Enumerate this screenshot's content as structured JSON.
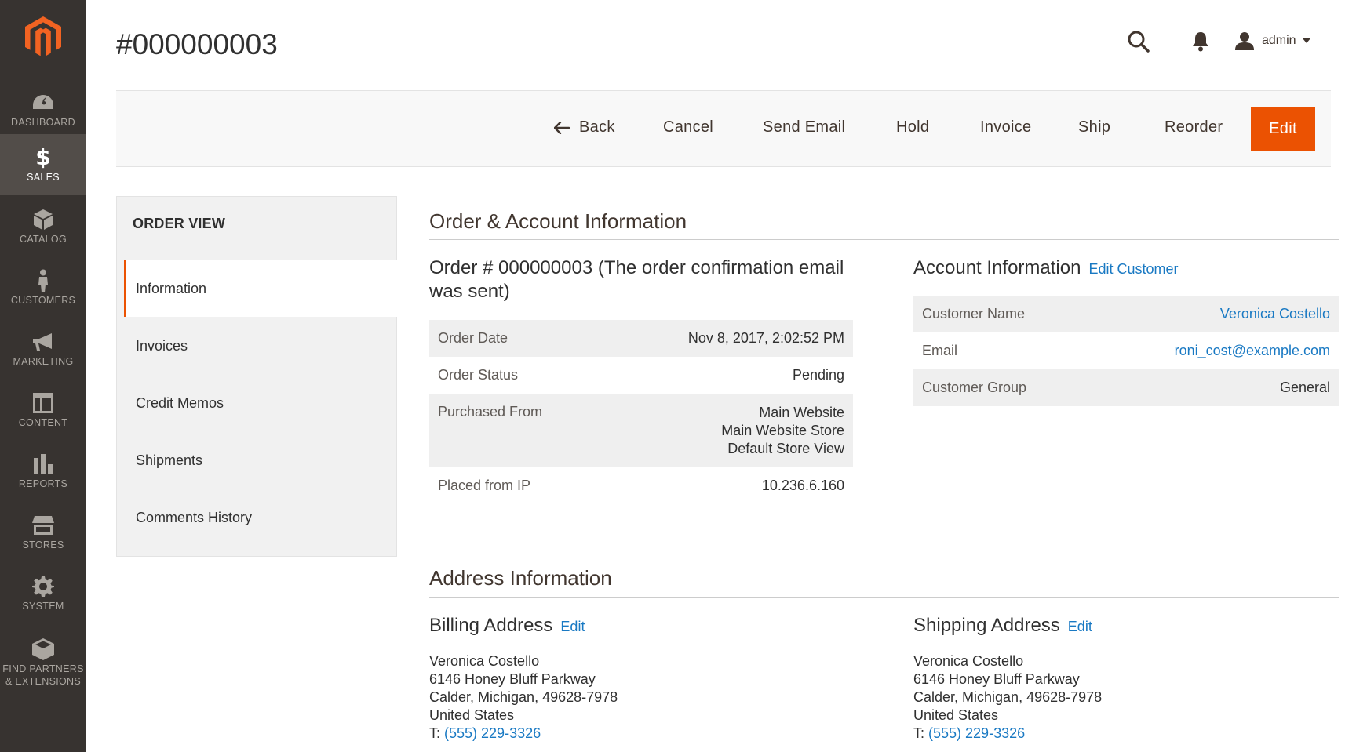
{
  "nav": {
    "items": [
      {
        "label": "DASHBOARD",
        "icon": "dashboard-icon"
      },
      {
        "label": "SALES",
        "icon": "dollar-icon",
        "active": true
      },
      {
        "label": "CATALOG",
        "icon": "box-icon"
      },
      {
        "label": "CUSTOMERS",
        "icon": "person-icon"
      },
      {
        "label": "MARKETING",
        "icon": "megaphone-icon"
      },
      {
        "label": "CONTENT",
        "icon": "layout-icon"
      },
      {
        "label": "REPORTS",
        "icon": "bar-chart-icon"
      },
      {
        "label": "STORES",
        "icon": "storefront-icon"
      },
      {
        "label": "SYSTEM",
        "icon": "gear-icon"
      },
      {
        "label": "FIND PARTNERS\n& EXTENSIONS",
        "label_line1": "FIND PARTNERS",
        "label_line2": "& EXTENSIONS",
        "icon": "package-icon"
      }
    ],
    "dollar_glyph": "$"
  },
  "header": {
    "title": "#000000003",
    "user": "admin"
  },
  "actions": {
    "back": "Back",
    "cancel": "Cancel",
    "send_email": "Send Email",
    "hold": "Hold",
    "invoice": "Invoice",
    "ship": "Ship",
    "reorder": "Reorder",
    "edit": "Edit"
  },
  "tabs": {
    "title": "ORDER VIEW",
    "items": [
      "Information",
      "Invoices",
      "Credit Memos",
      "Shipments",
      "Comments History"
    ]
  },
  "order_account": {
    "section_title": "Order & Account Information",
    "order_title_line1": "Order # 000000003 (The order confirmation email",
    "order_title_line2": "was sent)",
    "order_rows": {
      "date_label": "Order Date",
      "date_value": "Nov 8, 2017, 2:02:52 PM",
      "status_label": "Order Status",
      "status_value": "Pending",
      "from_label": "Purchased From",
      "from_line1": "Main Website",
      "from_line2": "Main Website Store",
      "from_line3": "Default Store View",
      "ip_label": "Placed from IP",
      "ip_value": "10.236.6.160"
    },
    "account_title": "Account Information",
    "account_edit": "Edit Customer",
    "account_rows": {
      "name_label": "Customer Name",
      "name_value": "Veronica Costello",
      "email_label": "Email",
      "email_value": "roni_cost@example.com",
      "group_label": "Customer Group",
      "group_value": "General"
    }
  },
  "address": {
    "section_title": "Address Information",
    "billing": {
      "title": "Billing Address",
      "edit": "Edit",
      "name": "Veronica Costello",
      "street": "6146 Honey Bluff Parkway",
      "city": "Calder, Michigan, 49628-7978",
      "country": "United States",
      "phone_prefix": "T: ",
      "phone": "(555) 229-3326"
    },
    "shipping": {
      "title": "Shipping Address",
      "edit": "Edit",
      "name": "Veronica Costello",
      "street": "6146 Honey Bluff Parkway",
      "city": "Calder, Michigan, 49628-7978",
      "country": "United States",
      "phone_prefix": "T: ",
      "phone": "(555) 229-3326"
    }
  },
  "colors": {
    "accent": "#eb5202",
    "nav_bg": "#373330",
    "link": "#1979c3"
  }
}
